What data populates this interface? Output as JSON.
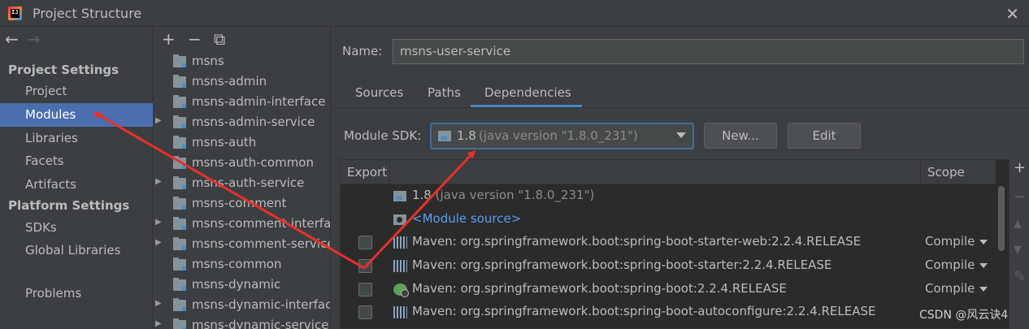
{
  "window": {
    "title": "Project Structure",
    "icon_text": "IJ"
  },
  "nav": {
    "project_settings_header": "Project Settings",
    "platform_settings_header": "Platform Settings",
    "items": {
      "project": "Project",
      "modules": "Modules",
      "libraries": "Libraries",
      "facets": "Facets",
      "artifacts": "Artifacts",
      "sdks": "SDKs",
      "global_libraries": "Global Libraries",
      "problems": "Problems"
    },
    "selected": "modules"
  },
  "tree": {
    "toolbar": {
      "add": "+",
      "remove": "−",
      "copy": "⧉"
    },
    "modules": [
      "msns",
      "msns-admin",
      "msns-admin-interface",
      "msns-admin-service",
      "msns-auth",
      "msns-auth-common",
      "msns-auth-service",
      "msns-comment",
      "msns-comment-interface",
      "msns-comment-service",
      "msns-common",
      "msns-dynamic",
      "msns-dynamic-interface",
      "msns-dynamic-service"
    ]
  },
  "module": {
    "name_label": "Name:",
    "name_value": "msns-user-service",
    "tabs": [
      "Sources",
      "Paths",
      "Dependencies"
    ],
    "active_tab": "Dependencies",
    "sdk_label": "Module SDK:",
    "sdk_value": "1.8",
    "sdk_version": "(java version \"1.8.0_231\")",
    "new_button": "New...",
    "edit_button": "Edit"
  },
  "dependencies": {
    "col_export": "Export",
    "col_scope": "Scope",
    "rows": [
      {
        "name": "1.8",
        "suffix": " (java version \"1.8.0_231\")",
        "scope": "",
        "checkbox": false
      },
      {
        "name": "<Module source>",
        "suffix": "",
        "scope": "",
        "checkbox": false
      },
      {
        "name": "Maven: org.springframework.boot:spring-boot-starter-web:2.2.4.RELEASE",
        "suffix": "",
        "scope": "Compile",
        "checkbox": true
      },
      {
        "name": "Maven: org.springframework.boot:spring-boot-starter:2.2.4.RELEASE",
        "suffix": "",
        "scope": "Compile",
        "checkbox": true
      },
      {
        "name": "Maven: org.springframework.boot:spring-boot:2.2.4.RELEASE",
        "suffix": "",
        "scope": "Compile",
        "checkbox": true
      },
      {
        "name": "Maven: org.springframework.boot:spring-boot-autoconfigure:2.2.4.RELEASE",
        "suffix": "",
        "scope": "",
        "checkbox": true
      }
    ]
  },
  "side_tools": {
    "add": "+",
    "remove": "−",
    "up": "▲",
    "down": "▼",
    "edit": "✎"
  },
  "watermark": "CSDN @风云诀4",
  "colors": {
    "background": "#3c3f41",
    "selection": "#4b6eaf",
    "table_bg": "#2b2b2b",
    "link": "#589df6",
    "annotation_arrow": "#e8302b"
  }
}
